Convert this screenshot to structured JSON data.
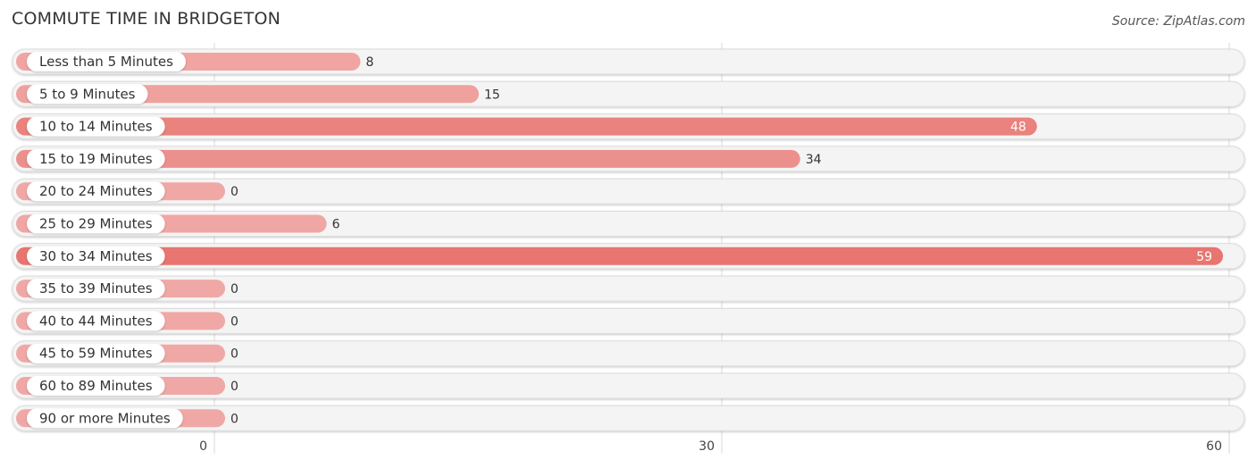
{
  "header": {
    "title": "COMMUTE TIME IN BRIDGETON",
    "source": "Source: ZipAtlas.com"
  },
  "colors": {
    "bar_strong": "#e8756f",
    "bar_light": "#f0a8a6",
    "track": "#f4f4f4",
    "grid": "#d8d8d8"
  },
  "chart_data": {
    "type": "bar",
    "orientation": "horizontal",
    "title": "COMMUTE TIME IN BRIDGETON",
    "xlabel": "",
    "ylabel": "",
    "xlim": [
      0,
      60
    ],
    "x_ticks": [
      0,
      30,
      60
    ],
    "grid": true,
    "categories": [
      "Less than 5 Minutes",
      "5 to 9 Minutes",
      "10 to 14 Minutes",
      "15 to 19 Minutes",
      "20 to 24 Minutes",
      "25 to 29 Minutes",
      "30 to 34 Minutes",
      "35 to 39 Minutes",
      "40 to 44 Minutes",
      "45 to 59 Minutes",
      "60 to 89 Minutes",
      "90 or more Minutes"
    ],
    "values": [
      8,
      15,
      48,
      34,
      0,
      6,
      59,
      0,
      0,
      0,
      0,
      0
    ]
  }
}
